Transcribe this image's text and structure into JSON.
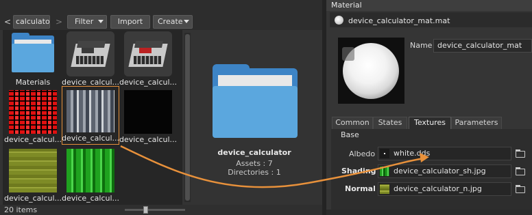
{
  "browser": {
    "back_glyph": "<",
    "path": "calculator",
    "forward_glyph": ">",
    "filter_label": "Filter",
    "import_label": "Import",
    "create_label": "Create",
    "assets": [
      {
        "name": "Materials",
        "kind": "folder"
      },
      {
        "name": "device_calcul...",
        "kind": "model"
      },
      {
        "name": "device_calcul...",
        "kind": "model"
      },
      {
        "name": "device_calcul...",
        "kind": "texture-red"
      },
      {
        "name": "device_calcul...",
        "kind": "texture-photo",
        "selected": true
      },
      {
        "name": "device_calcul...",
        "kind": "texture-black"
      },
      {
        "name": "device_calcul...",
        "kind": "texture-olive"
      },
      {
        "name": "device_calcul...",
        "kind": "texture-green"
      }
    ],
    "status": "20 items",
    "zoom_level": 0.35
  },
  "preview": {
    "title": "device_calculator",
    "assets_line": "Assets : 7",
    "directories_line": "Directories : 1"
  },
  "editor": {
    "header": "Material",
    "material_file": "device_calculator_mat.mat",
    "name_label": "Name",
    "name_value": "device_calculator_mat",
    "tabs": [
      "Common",
      "States",
      "Textures",
      "Parameters"
    ],
    "active_tab": "Textures",
    "section": "Base",
    "textures": [
      {
        "label": "Albedo",
        "value": "white.dds",
        "swatch": "white"
      },
      {
        "label": "Shading",
        "value": "device_calculator_sh.jpg",
        "swatch": "sh"
      },
      {
        "label": "Normal",
        "value": "device_calculator_n.jpg",
        "swatch": "nm"
      }
    ]
  },
  "colors": {
    "accent_orange": "#e8913b",
    "folder_blue": "#5ba7de",
    "panel_bg": "#333333"
  },
  "icons": {
    "folder": "folder-icon",
    "material_sphere": "material-sphere-icon",
    "browse": "open-folder-icon"
  }
}
